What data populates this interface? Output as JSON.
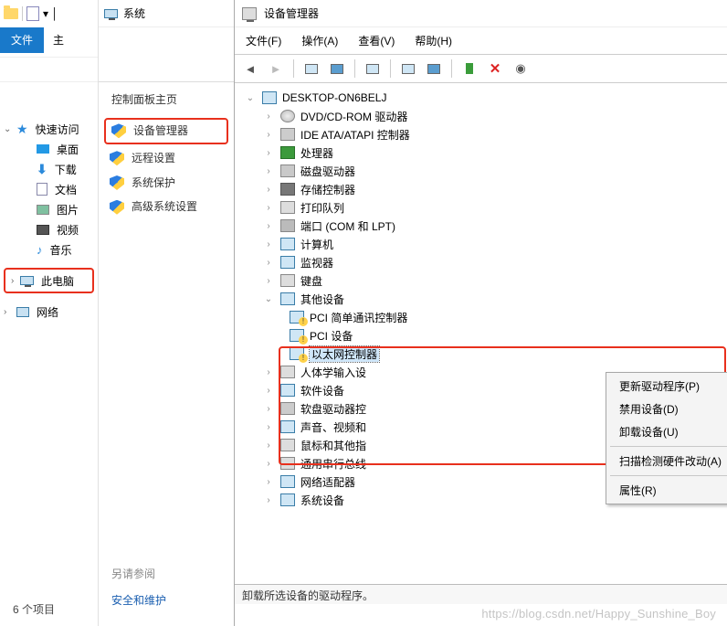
{
  "explorer": {
    "tab_file": "文件",
    "tab_home": "主",
    "quick_access": "快速访问",
    "items": [
      {
        "label": "桌面",
        "icon": "desktop"
      },
      {
        "label": "下载",
        "icon": "download"
      },
      {
        "label": "文档",
        "icon": "doc"
      },
      {
        "label": "图片",
        "icon": "images"
      },
      {
        "label": "视频",
        "icon": "videos"
      },
      {
        "label": "音乐",
        "icon": "music"
      }
    ],
    "this_pc": "此电脑",
    "network": "网络",
    "footer": "6 个项目"
  },
  "system_panel": {
    "title": "系统",
    "heading": "控制面板主页",
    "links": [
      {
        "label": "设备管理器",
        "highlight": true
      },
      {
        "label": "远程设置",
        "highlight": false
      },
      {
        "label": "系统保护",
        "highlight": false
      },
      {
        "label": "高级系统设置",
        "highlight": false
      }
    ],
    "see_also": "另请参阅",
    "security": "安全和维护"
  },
  "devmgr": {
    "title": "设备管理器",
    "menu": [
      {
        "label": "文件(F)"
      },
      {
        "label": "操作(A)"
      },
      {
        "label": "查看(V)"
      },
      {
        "label": "帮助(H)"
      }
    ],
    "root": "DESKTOP-ON6BELJ",
    "categories": [
      {
        "label": "DVD/CD-ROM 驱动器",
        "ico": "disc"
      },
      {
        "label": "IDE ATA/ATAPI 控制器",
        "ico": "ide"
      },
      {
        "label": "处理器",
        "ico": "chip"
      },
      {
        "label": "磁盘驱动器",
        "ico": "drive"
      },
      {
        "label": "存储控制器",
        "ico": "ctrl"
      },
      {
        "label": "打印队列",
        "ico": "printer"
      },
      {
        "label": "端口 (COM 和 LPT)",
        "ico": "port"
      },
      {
        "label": "计算机",
        "ico": "pc"
      },
      {
        "label": "监视器",
        "ico": "mon"
      },
      {
        "label": "键盘",
        "ico": "kb"
      }
    ],
    "other_devices": "其他设备",
    "other_children": [
      {
        "label": "PCI 简单通讯控制器"
      },
      {
        "label": "PCI 设备"
      },
      {
        "label": "以太网控制器",
        "selected": true
      }
    ],
    "after": [
      {
        "label": "人体学输入设",
        "ico": "hid"
      },
      {
        "label": "软件设备",
        "ico": "sw"
      },
      {
        "label": "软盘驱动器控",
        "ico": "fdd"
      },
      {
        "label": "声音、视频和",
        "ico": "snd"
      },
      {
        "label": "鼠标和其他指",
        "ico": "mouse"
      },
      {
        "label": "通用串行总线",
        "ico": "usb"
      },
      {
        "label": "网络适配器",
        "ico": "net"
      },
      {
        "label": "系统设备",
        "ico": "sys"
      }
    ],
    "context_menu": [
      {
        "label": "更新驱动程序(P)"
      },
      {
        "label": "禁用设备(D)"
      },
      {
        "label": "卸载设备(U)"
      },
      {
        "sep": true
      },
      {
        "label": "扫描检测硬件改动(A)"
      },
      {
        "sep": true
      },
      {
        "label": "属性(R)"
      }
    ],
    "status": "卸载所选设备的驱动程序。"
  },
  "watermark": "https://blog.csdn.net/Happy_Sunshine_Boy"
}
